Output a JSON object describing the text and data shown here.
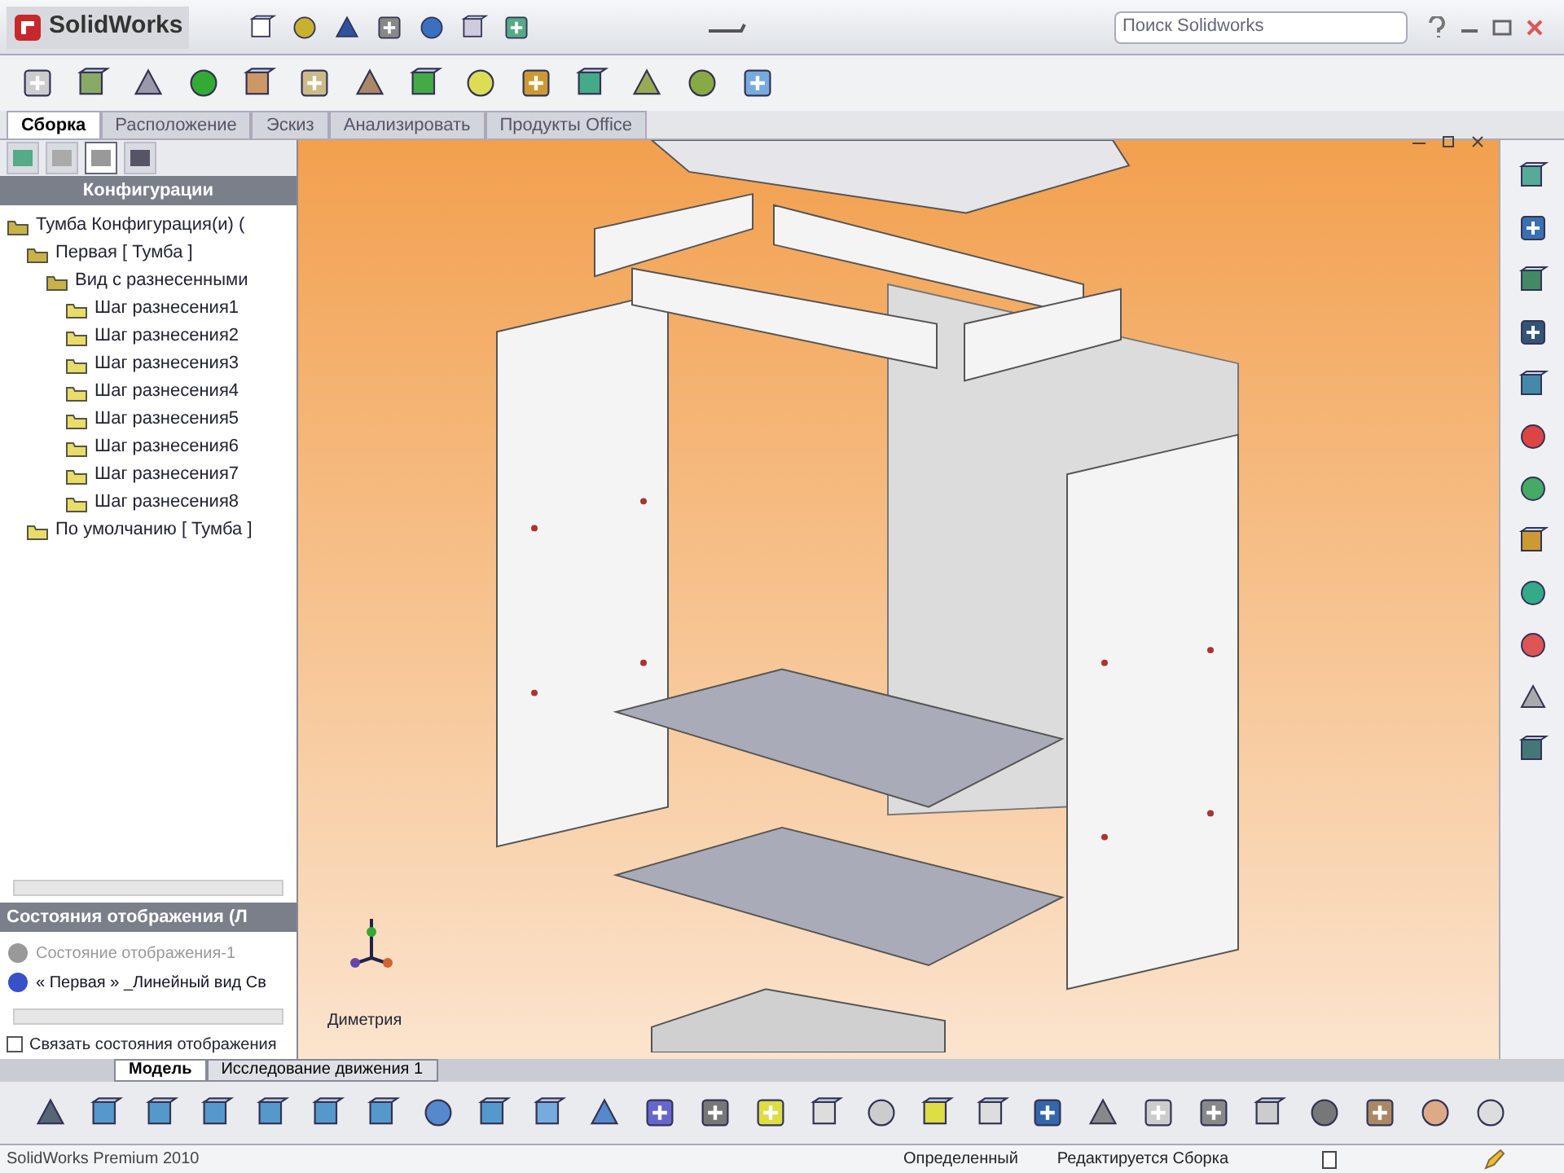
{
  "window": {
    "app_name": "SolidWorks",
    "search": {
      "placeholder": "Поиск Solidworks"
    }
  },
  "command_tabs": [
    {
      "label": "Сборка",
      "selected": true
    },
    {
      "label": "Расположение",
      "selected": false
    },
    {
      "label": "Эскиз",
      "selected": false
    },
    {
      "label": "Анализировать",
      "selected": false
    },
    {
      "label": "Продукты Office",
      "selected": false
    }
  ],
  "manager_tabs": [
    {
      "selected": false
    },
    {
      "selected": false
    },
    {
      "selected": true
    },
    {
      "selected": false
    }
  ],
  "config_panel": {
    "title": "Конфигурации",
    "tree": [
      {
        "label": "Тумба Конфигурация(и) (",
        "children": [
          {
            "label": "Первая [ Тумба ]",
            "children": [
              {
                "label": "Вид с разнесенными",
                "children": [
                  {
                    "label": "Шаг разнесения1"
                  },
                  {
                    "label": "Шаг разнесения2"
                  },
                  {
                    "label": "Шаг разнесения3"
                  },
                  {
                    "label": "Шаг разнесения4"
                  },
                  {
                    "label": "Шаг разнесения5"
                  },
                  {
                    "label": "Шаг разнесения6"
                  },
                  {
                    "label": "Шаг разнесения7"
                  },
                  {
                    "label": "Шаг разнесения8"
                  }
                ]
              }
            ]
          },
          {
            "label": "По умолчанию [ Тумба ]"
          }
        ]
      }
    ]
  },
  "display_states": {
    "title": "Состояния отображения (Л",
    "items": [
      {
        "label": "Состояние отображения-1",
        "selected": false
      },
      {
        "label": "« Первая » _Линейный вид Св",
        "selected": true
      }
    ],
    "link_checkbox": {
      "label": "Связать состояния отображения",
      "checked": false
    }
  },
  "viewport": {
    "view_label": "Диметрия"
  },
  "bottom_tabs": [
    {
      "label": "Модель",
      "selected": true
    },
    {
      "label": "Исследование движения 1",
      "selected": false
    }
  ],
  "status_bar": {
    "product": "SolidWorks Premium 2010",
    "state": "Определенный",
    "mode": "Редактируется Сборка"
  }
}
